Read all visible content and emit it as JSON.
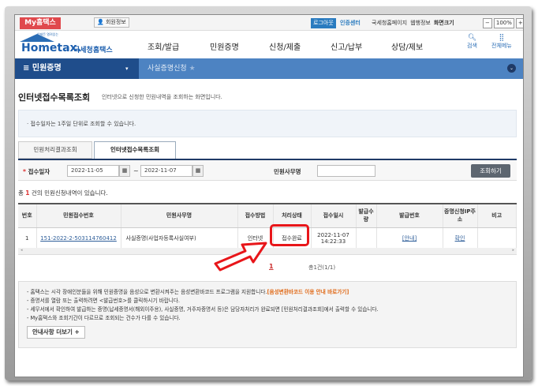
{
  "topbar": {
    "my": "My홈택스",
    "member": "회원정보",
    "logout": "로그아웃",
    "cert": "인증센터",
    "links": [
      "국세청홈페이지",
      "웹행정보",
      "화면크기"
    ],
    "zoom": "100%",
    "minus": "−",
    "plus": "+"
  },
  "header": {
    "logo": "Hometax.",
    "logo_ko": "국세청홈택스",
    "logo_tag": "언제든 열려있는",
    "nav": [
      "조회/발급",
      "민원증명",
      "신청/제출",
      "신고/납부",
      "상담/제보"
    ],
    "search": "검색",
    "allmenu": "전체메뉴"
  },
  "menu": {
    "current": "민원증명",
    "crumb": "사실증명신청"
  },
  "page": {
    "title": "인터넷접수목록조회",
    "subtitle": "인터넷으로 신청한 민원내역을 조회하는 화면입니다.",
    "notice": "· 접수일자는 1주일 단위로 조회할 수 있습니다."
  },
  "tabs": [
    "민원처리결과조회",
    "인터넷접수목록조회"
  ],
  "search": {
    "date_label": "접수일자",
    "from": "2022-11-05",
    "tilde": "~",
    "to": "2022-11-07",
    "office_label": "민원사무명",
    "office_value": "",
    "button": "조회하기",
    "req": "*"
  },
  "count": {
    "pre": "총 ",
    "num": "1",
    "post": " 건의 민원신청내역이 있습니다."
  },
  "table": {
    "headers": [
      "번호",
      "민원접수번호",
      "민원사무명",
      "접수방법",
      "처리상태",
      "접수일시",
      "발급수량",
      "발급번호",
      "증명신청IP주소",
      "비고"
    ],
    "row": {
      "no": "1",
      "receipt": "151-2022-2-503114760412",
      "name": "사실증명(사업자등록사실여부)",
      "method": "인터넷",
      "status": "접수완료",
      "date": "2022-11-07",
      "time": "14:22:33",
      "qty": "",
      "issue": "[안내]",
      "ip": "확인",
      "note": ""
    }
  },
  "pager": {
    "page": "1",
    "total": "총1건(1/1)"
  },
  "info": {
    "lines": [
      "- 홈택스는 시각 장애인분들을 위해 민원증명을 음성으로 변환시켜주는 음성변환바코드 프로그램을 지원합니다.",
      "- 증명서를 열람 또는 출력하려면 <발급번호>를 클릭하시기 바랍니다.",
      "- 세무서에서 확인하여 발급하는 증명(납세증명서(해외이주용), 사실증명, 거주자증명서 등)은 담당자처리가 완료되면 [민원처리결과조회]에서 출력할 수 있습니다.",
      "- My홈택스와 조회기간이 다르므로 조회되는 건수가 다를 수 있습니다."
    ],
    "link": "[음성변환바코드 이용 안내 바로가기]",
    "more": "안내사항 더보기 +"
  },
  "colors": {
    "accent": "#e0494d",
    "blue": "#4d83c2",
    "dark": "#1f4d8b",
    "highlight": "#e8161a"
  }
}
